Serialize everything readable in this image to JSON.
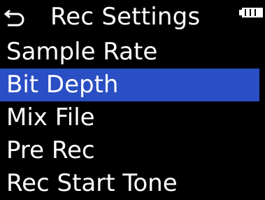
{
  "header": {
    "title": "Rec Settings",
    "back_icon": "return-arrow-icon",
    "battery_icon": "battery-full-icon"
  },
  "menu": {
    "items": [
      {
        "label": "Sample Rate"
      },
      {
        "label": "Bit Depth"
      },
      {
        "label": "Mix File"
      },
      {
        "label": "Pre Rec"
      },
      {
        "label": "Rec Start Tone"
      }
    ],
    "selected_label": "Bit Depth"
  },
  "colors": {
    "background": "#000000",
    "text": "#ffffff",
    "selection": "#2a4fc4"
  }
}
